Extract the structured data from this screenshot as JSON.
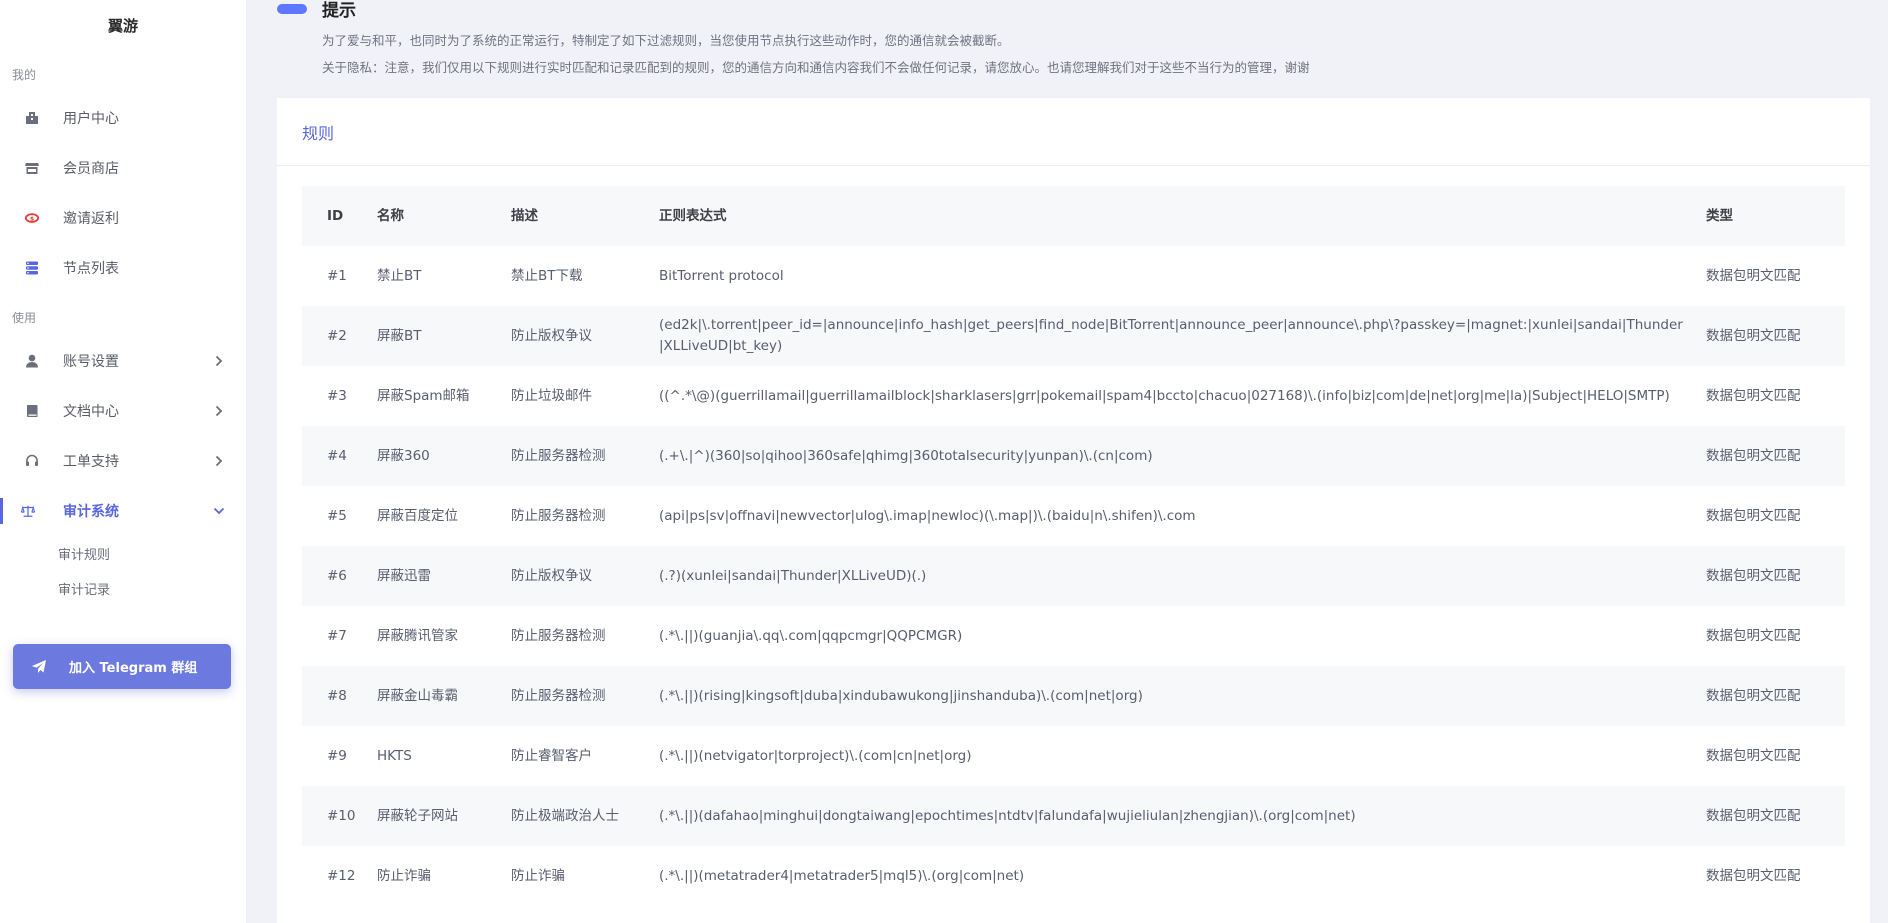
{
  "brand": "翼游",
  "sidebar": {
    "section_mine": "我的",
    "section_use": "使用",
    "items_mine": [
      {
        "label": "用户中心",
        "icon": "building-icon"
      },
      {
        "label": "会员商店",
        "icon": "store-icon"
      },
      {
        "label": "邀请返利",
        "icon": "money-icon"
      },
      {
        "label": "节点列表",
        "icon": "server-icon"
      }
    ],
    "items_use": [
      {
        "label": "账号设置",
        "icon": "user-icon"
      },
      {
        "label": "文档中心",
        "icon": "book-icon"
      },
      {
        "label": "工单支持",
        "icon": "headset-icon"
      },
      {
        "label": "审计系统",
        "icon": "balance-scale-icon"
      }
    ],
    "audit_sub": [
      "审计规则",
      "审计记录"
    ],
    "telegram_button": "加入 Telegram 群组"
  },
  "notice": {
    "title": "提示",
    "line1": "为了爱与和平，也同时为了系统的正常运行，特制定了如下过滤规则，当您使用节点执行这些动作时，您的通信就会被截断。",
    "line2": "关于隐私：注意，我们仅用以下规则进行实时匹配和记录匹配到的规则，您的通信方向和通信内容我们不会做任何记录，请您放心。也请您理解我们对于这些不当行为的管理，谢谢"
  },
  "card": {
    "title": "规则"
  },
  "table": {
    "headers": {
      "id": "ID",
      "name": "名称",
      "desc": "描述",
      "regex": "正则表达式",
      "type": "类型"
    },
    "rows": [
      {
        "id": "#1",
        "name": "禁止BT",
        "desc": "禁止BT下载",
        "regex": "BitTorrent protocol",
        "type": "数据包明文匹配"
      },
      {
        "id": "#2",
        "name": "屏蔽BT",
        "desc": "防止版权争议",
        "regex": "(ed2k|\\.torrent|peer_id=|announce|info_hash|get_peers|find_node|BitTorrent|announce_peer|announce\\.php\\?passkey=|magnet:|xunlei|sandai|Thunder|XLLiveUD|bt_key)",
        "type": "数据包明文匹配"
      },
      {
        "id": "#3",
        "name": "屏蔽Spam邮箱",
        "desc": "防止垃圾邮件",
        "regex": "((^.*\\@)(guerrillamail|guerrillamailblock|sharklasers|grr|pokemail|spam4|bccto|chacuo|027168)\\.(info|biz|com|de|net|org|me|la)|Subject|HELO|SMTP)",
        "type": "数据包明文匹配"
      },
      {
        "id": "#4",
        "name": "屏蔽360",
        "desc": "防止服务器检测",
        "regex": "(.+\\.|^)(360|so|qihoo|360safe|qhimg|360totalsecurity|yunpan)\\.(cn|com)",
        "type": "数据包明文匹配"
      },
      {
        "id": "#5",
        "name": "屏蔽百度定位",
        "desc": "防止服务器检测",
        "regex": "(api|ps|sv|offnavi|newvector|ulog\\.imap|newloc)(\\.map|)\\.(baidu|n\\.shifen)\\.com",
        "type": "数据包明文匹配"
      },
      {
        "id": "#6",
        "name": "屏蔽迅雷",
        "desc": "防止版权争议",
        "regex": "(.?)(xunlei|sandai|Thunder|XLLiveUD)(.)",
        "type": "数据包明文匹配"
      },
      {
        "id": "#7",
        "name": "屏蔽腾讯管家",
        "desc": "防止服务器检测",
        "regex": "(.*\\.||)(guanjia\\.qq\\.com|qqpcmgr|QQPCMGR)",
        "type": "数据包明文匹配"
      },
      {
        "id": "#8",
        "name": "屏蔽金山毒霸",
        "desc": "防止服务器检测",
        "regex": "(.*\\.||)(rising|kingsoft|duba|xindubawukong|jinshanduba)\\.(com|net|org)",
        "type": "数据包明文匹配"
      },
      {
        "id": "#9",
        "name": "HKTS",
        "desc": "防止睿智客户",
        "regex": "(.*\\.||)(netvigator|torproject)\\.(com|cn|net|org)",
        "type": "数据包明文匹配"
      },
      {
        "id": "#10",
        "name": "屏蔽轮子网站",
        "desc": "防止极端政治人士",
        "regex": "(.*\\.||)(dafahao|minghui|dongtaiwang|epochtimes|ntdtv|falundafa|wujieliulan|zhengjian)\\.(org|com|net)",
        "type": "数据包明文匹配"
      },
      {
        "id": "#12",
        "name": "防止诈骗",
        "desc": "防止诈骗",
        "regex": "(.*\\.||)(metatrader4|metatrader5|mql5)\\.(org|com|net)",
        "type": "数据包明文匹配"
      }
    ]
  },
  "colors": {
    "accent": "#5867dd",
    "telegram": "#6c7ae0",
    "invite_icon": "#e53935"
  }
}
